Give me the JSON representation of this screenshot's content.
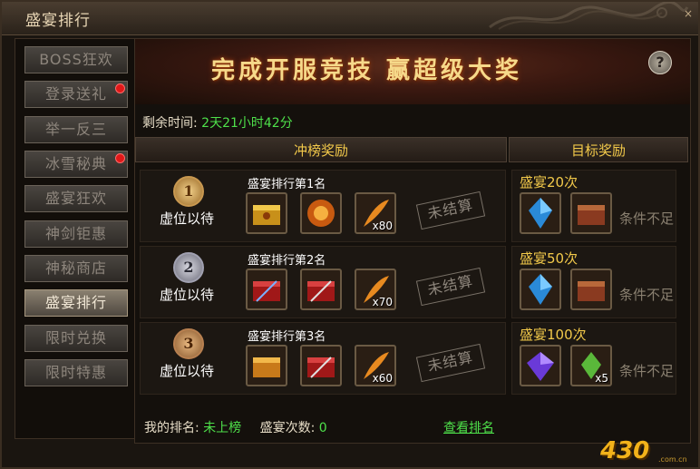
{
  "window": {
    "title": "盛宴排行",
    "close_glyph": "×"
  },
  "sidebar": {
    "tabs": [
      {
        "label": "BOSS狂欢",
        "dot": false,
        "active": false
      },
      {
        "label": "登录送礼",
        "dot": true,
        "active": false
      },
      {
        "label": "举一反三",
        "dot": false,
        "active": false
      },
      {
        "label": "冰雪秘典",
        "dot": true,
        "active": false
      },
      {
        "label": "盛宴狂欢",
        "dot": false,
        "active": false
      },
      {
        "label": "神剑钜惠",
        "dot": false,
        "active": false
      },
      {
        "label": "神秘商店",
        "dot": false,
        "active": false
      },
      {
        "label": "盛宴排行",
        "dot": false,
        "active": true
      },
      {
        "label": "限时兑换",
        "dot": false,
        "active": false
      },
      {
        "label": "限时特惠",
        "dot": false,
        "active": false
      }
    ]
  },
  "banner": {
    "text": "完成开服竞技  赢超级大奖",
    "help_glyph": "?"
  },
  "remaining": {
    "label": "剩余时间:",
    "value": "2天21小时42分"
  },
  "headers": {
    "rank_rewards": "冲榜奖励",
    "target_rewards": "目标奖励"
  },
  "ranks": [
    {
      "medal": "1",
      "holder": "虚位以待",
      "name": "盛宴排行第1名",
      "qty": "x80",
      "status": "未结算"
    },
    {
      "medal": "2",
      "holder": "虚位以待",
      "name": "盛宴排行第2名",
      "qty": "x70",
      "status": "未结算"
    },
    {
      "medal": "3",
      "holder": "虚位以待",
      "name": "盛宴排行第3名",
      "qty": "x60",
      "status": "未结算"
    }
  ],
  "targets": [
    {
      "label": "盛宴20次",
      "condition": "条件不足",
      "qty": ""
    },
    {
      "label": "盛宴50次",
      "condition": "条件不足",
      "qty": ""
    },
    {
      "label": "盛宴100次",
      "condition": "条件不足",
      "qty": "x5"
    }
  ],
  "footer": {
    "my_rank_label": "我的排名:",
    "my_rank_value": "未上榜",
    "count_label": "盛宴次数:",
    "count_value": "0",
    "view_rank": "查看排名"
  },
  "logo": {
    "text": "430",
    "sub": ".com.cn"
  },
  "colors": {
    "gold": "#f2c94a",
    "green": "#4ee04a",
    "red_dot": "#e01818"
  }
}
